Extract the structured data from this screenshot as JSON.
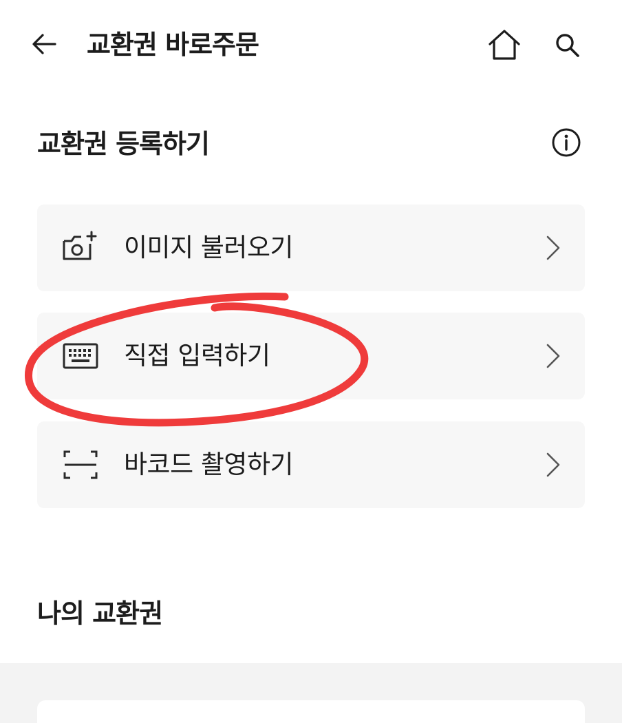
{
  "header": {
    "title": "교환권 바로주문",
    "back_icon": "arrow-left-icon",
    "home_icon": "home-icon",
    "search_icon": "search-icon"
  },
  "register": {
    "title": "교환권 등록하기",
    "info_icon": "info-icon",
    "options": [
      {
        "label": "이미지 불러오기",
        "icon": "camera-plus-icon"
      },
      {
        "label": "직접 입력하기",
        "icon": "keyboard-icon"
      },
      {
        "label": "바코드 촬영하기",
        "icon": "barcode-scan-icon"
      }
    ],
    "chevron_icon": "chevron-right-icon"
  },
  "my_vouchers": {
    "title": "나의 교환권"
  },
  "annotation": {
    "color": "#ef3b3b",
    "shape": "hand-drawn-circle"
  }
}
